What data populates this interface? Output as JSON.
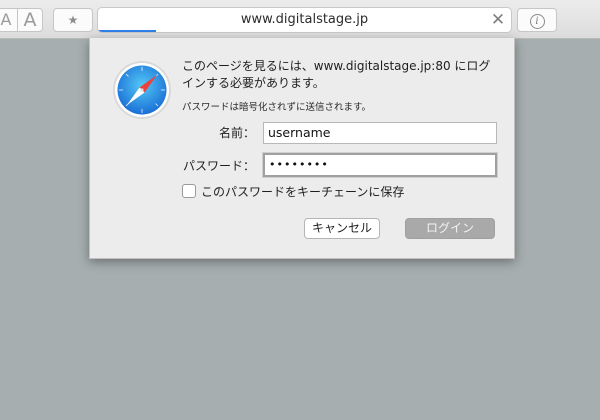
{
  "toolbar": {
    "font_small": "A",
    "font_large": "A",
    "star": "★",
    "url": "www.digitalstage.jp",
    "close": "✕",
    "info": "i"
  },
  "dialog": {
    "message": "このページを見るには、www.digitalstage.jp:80 にログインする必要があります。",
    "note": "パスワードは暗号化されずに送信されます。",
    "name_label": "名前：",
    "username_value": "username",
    "password_label": "パスワード：",
    "password_value": "••••••••",
    "save_checkbox_label": "このパスワードをキーチェーンに保存",
    "save_checked": false,
    "cancel_label": "キャンセル",
    "login_label": "ログイン"
  },
  "colors": {
    "background": "#a6aeaf",
    "accent": "#2f80ea",
    "disabled_button": "#a9a9a9"
  },
  "icons": {
    "app_icon": "safari-compass-icon"
  }
}
